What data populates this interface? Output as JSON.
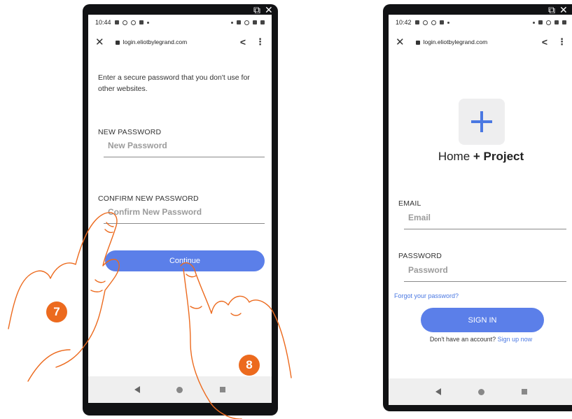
{
  "left_phone": {
    "status_time": "10:44",
    "url": "login.eliotbylegrand.com",
    "intro_text": "Enter a secure password that you don't use for other websites.",
    "new_password_label": "NEW PASSWORD",
    "new_password_placeholder": "New Password",
    "confirm_password_label": "CONFIRM NEW PASSWORD",
    "confirm_password_placeholder": "Confirm New Password",
    "continue_label": "Continue"
  },
  "right_phone": {
    "status_time": "10:42",
    "url": "login.eliotbylegrand.com",
    "brand_prefix": "Home ",
    "brand_bold": "+ Project",
    "email_label": "EMAIL",
    "email_placeholder": "Email",
    "password_label": "PASSWORD",
    "password_placeholder": "Password",
    "forgot_label": "Forgot your password?",
    "sign_in_label": "SIGN IN",
    "no_account_text": "Don't have an account?",
    "sign_up_label": "Sign up now"
  },
  "steps": {
    "step_a": "7",
    "step_b": "8"
  },
  "colors": {
    "accent": "#5b7fe9",
    "link": "#4a78e2",
    "badge": "#ec6a1e",
    "hand_stroke": "#ec6a1e"
  },
  "icons": {
    "close": "close-icon",
    "lock": "lock-icon",
    "share": "share-icon",
    "menu": "more-vert-icon",
    "back": "back-icon",
    "home": "home-icon",
    "recent": "recent-apps-icon",
    "external": "external-link-icon",
    "window_close": "window-close-icon"
  }
}
